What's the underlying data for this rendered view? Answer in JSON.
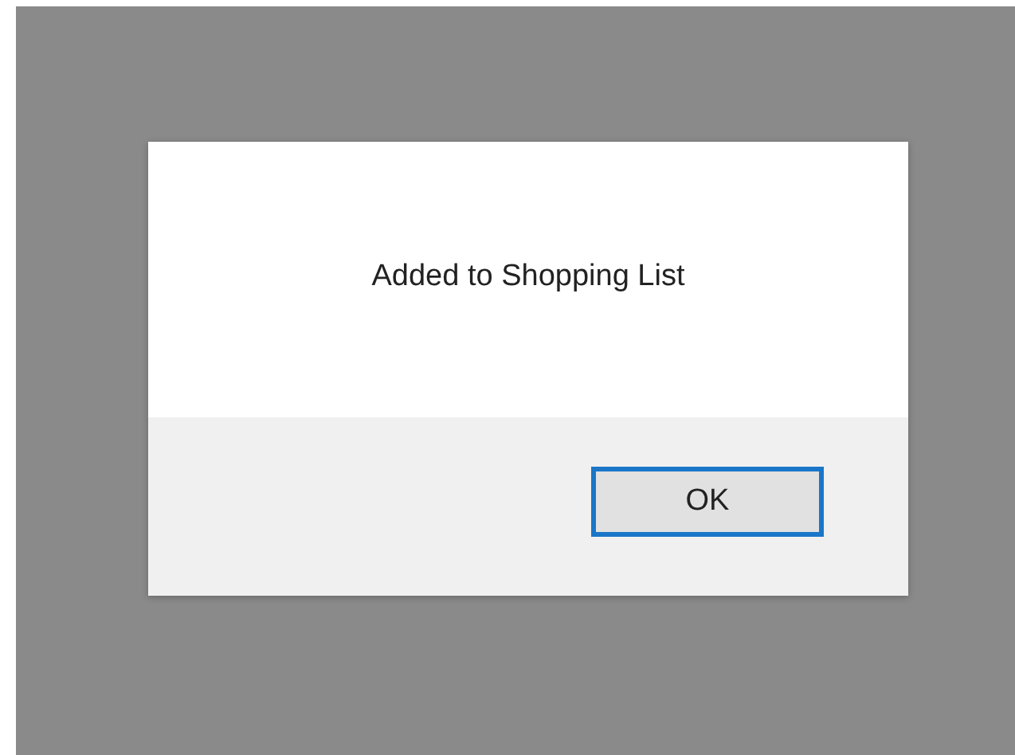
{
  "dialog": {
    "message": "Added to Shopping List",
    "buttons": [
      "OK"
    ]
  }
}
